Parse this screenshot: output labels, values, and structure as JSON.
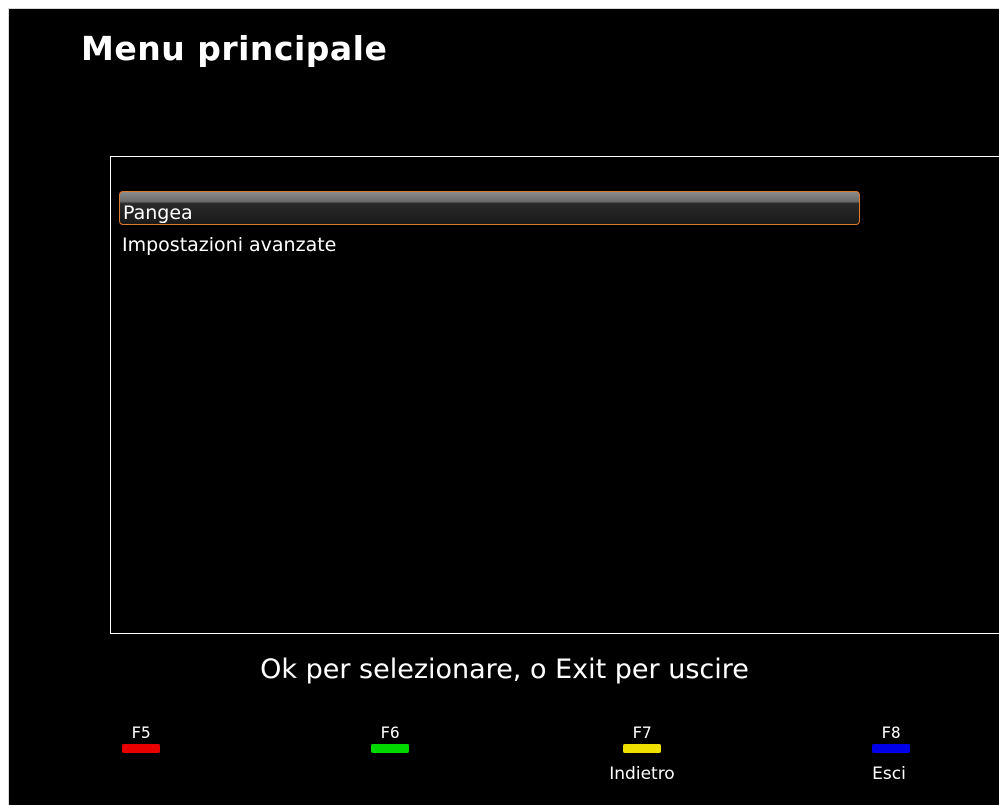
{
  "title": "Menu principale",
  "menu": {
    "items": [
      {
        "label": "Pangea",
        "selected": true
      },
      {
        "label": "Impostazioni avanzate",
        "selected": false
      }
    ]
  },
  "hint": "Ok per selezionare, o Exit per uscire",
  "fkeys": [
    {
      "key": "F5",
      "color": "#e80000",
      "action": ""
    },
    {
      "key": "F6",
      "color": "#00d800",
      "action": ""
    },
    {
      "key": "F7",
      "color": "#f0e000",
      "action": "Indietro"
    },
    {
      "key": "F8",
      "color": "#0000e8",
      "action": "Esci"
    }
  ],
  "colors": {
    "background": "#000000",
    "selection_border": "#e07a2c"
  }
}
